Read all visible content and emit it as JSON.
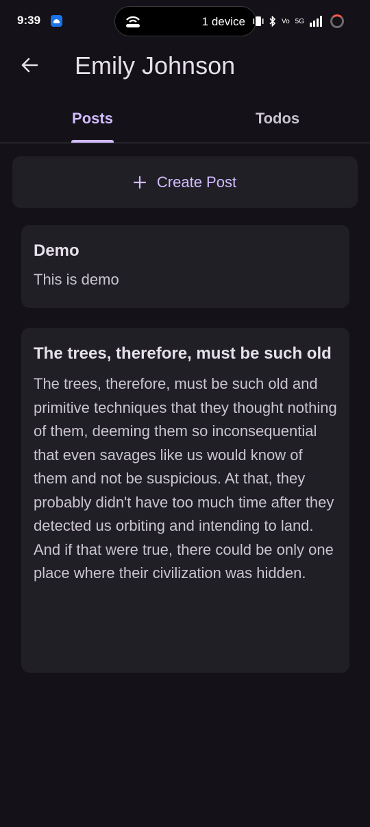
{
  "status_bar": {
    "time": "9:39",
    "device_pill_text": "1 device",
    "network_label": "5G",
    "volte_label": "Vo"
  },
  "app_bar": {
    "title": "Emily Johnson"
  },
  "tabs": [
    {
      "label": "Posts",
      "selected": true
    },
    {
      "label": "Todos",
      "selected": false
    }
  ],
  "create_post": {
    "label": "Create Post",
    "icon": "plus-icon"
  },
  "posts": [
    {
      "title": "Demo",
      "body": "This is demo"
    },
    {
      "title": "The trees, therefore, must be such old",
      "body": "The trees, therefore, must be such old and primitive techniques that they thought nothing of them, deeming them so inconsequential that even savages like us would know of them and not be suspicious. At that, they probably didn't have too much time after they detected us orbiting and intending to land. And if that were true, there could be only one place where their civilization was hidden."
    }
  ],
  "colors": {
    "background": "#141218",
    "surface": "#211f26",
    "accent": "#d0bcff",
    "on_surface": "#e6e0e9",
    "on_surface_variant": "#cac4d0"
  }
}
